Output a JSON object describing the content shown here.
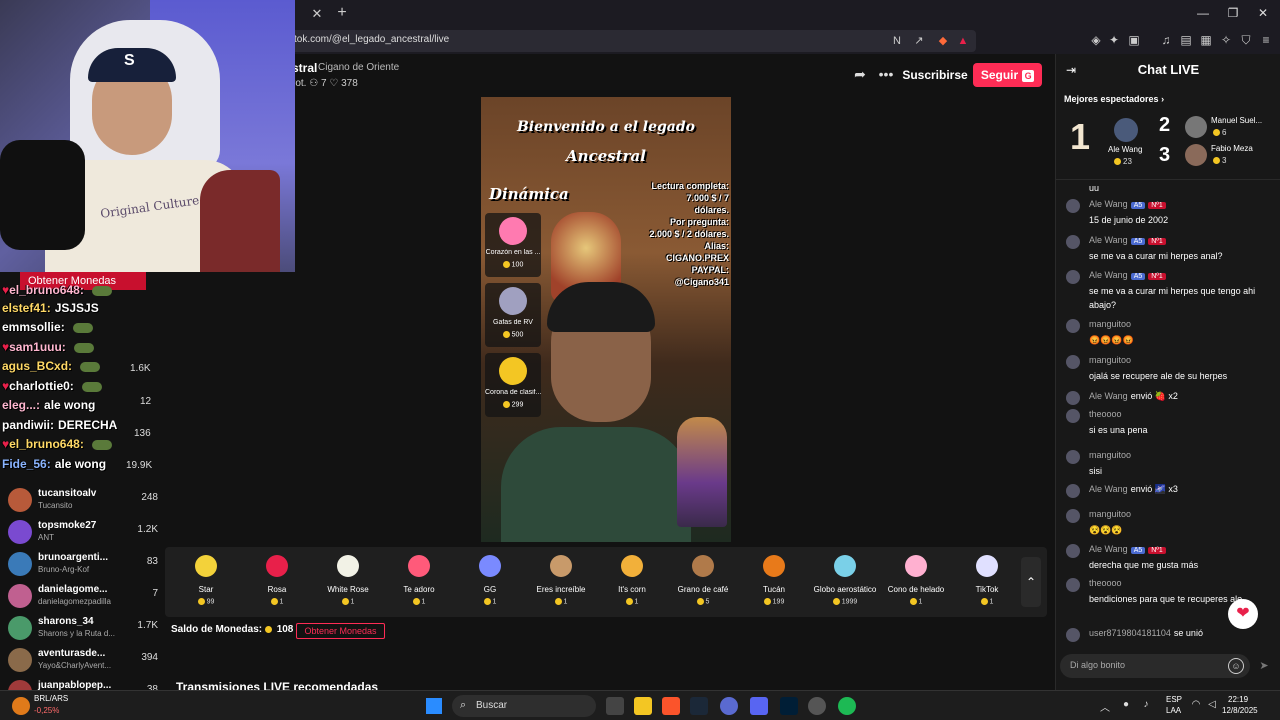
{
  "browser": {
    "url": "tok.com/@el_legado_ancestral/live",
    "tab_close": "✕",
    "tab_new": "+",
    "min": "—",
    "restore": "❐",
    "close": "✕"
  },
  "stream": {
    "name_fragment": "stral",
    "subtitle": "Cigano de Oriente",
    "stats_prefix": "rot.",
    "members": "7",
    "likes": "378",
    "subscribe": "Suscribirse",
    "follow": "Seguir",
    "follow_key": "G"
  },
  "webcam": {
    "shirt_text": "Original Culture",
    "hat_logo": "S"
  },
  "overlay_chat": {
    "coin_button": "Obtener Monedas",
    "lines": [
      {
        "name": "el_bruno648:",
        "msg": "",
        "heart": true,
        "color": "pink"
      },
      {
        "name": "elstef41:",
        "msg": "JSJSJS",
        "heart": false,
        "color": "y"
      },
      {
        "name": "emmsollie:",
        "msg": "",
        "heart": false,
        "color": "w"
      },
      {
        "name": "sam1uuu:",
        "msg": "",
        "heart": true,
        "color": "pink"
      },
      {
        "name": "agus_BCxd:",
        "msg": "",
        "heart": false,
        "color": "y"
      },
      {
        "name": "charlottie0:",
        "msg": "",
        "heart": true,
        "color": "w"
      },
      {
        "name": "eleg...:",
        "msg": "ale wong",
        "heart": false,
        "color": "pink"
      },
      {
        "name": "pandiwii:",
        "msg": "DERECHA",
        "heart": false,
        "color": "w"
      },
      {
        "name": "el_bruno648:",
        "msg": "",
        "heart": true,
        "color": "y"
      },
      {
        "name": "Fide_56:",
        "msg": "ale wong",
        "heart": false,
        "color": "b"
      }
    ]
  },
  "sidebar": {
    "items": [
      {
        "name": "tucansitoalv",
        "sub": "Tucansito",
        "count": "248"
      },
      {
        "name": "topsmoke27",
        "sub": "ANT",
        "count": "1.2K"
      },
      {
        "name": "brunoargenti...",
        "sub": "Bruno-Arg-Kof",
        "count": "83"
      },
      {
        "name": "danielagome...",
        "sub": "danielagomezpadilla",
        "count": "7"
      },
      {
        "name": "sharons_34",
        "sub": "Sharons y la Ruta d...",
        "count": "1.7K"
      },
      {
        "name": "aventurasde...",
        "sub": "Yayo&CharlyAvent...",
        "count": "394"
      },
      {
        "name": "juanpablopер...",
        "sub": "",
        "count": "38"
      }
    ],
    "hidden_counts": [
      "1.6K",
      "12",
      "136",
      "19.9K"
    ]
  },
  "video": {
    "title1": "Bienvenido a el legado",
    "title2": "Ancestral",
    "dinamica": "Dinámica",
    "info_lines": [
      "Lectura completa:",
      "7.000 $ / 7",
      "dólares.",
      "Por pregunta:",
      "2.000 $ / 2 dólares.",
      "Alias:",
      "CIGANO.PREX",
      "PAYPAL:",
      "@Cigano341"
    ],
    "gifts": [
      {
        "label": "Corazón en las ...",
        "count": "100",
        "color": "#ff7ab0"
      },
      {
        "label": "Gafas de RV",
        "count": "500",
        "color": "#a0a0c0"
      },
      {
        "label": "Corona de clasif...",
        "count": "299",
        "color": "#f3c623"
      }
    ]
  },
  "gift_bar": {
    "gifts": [
      {
        "name": "Star",
        "price": "99",
        "color": "#f3d23a"
      },
      {
        "name": "Rosa",
        "price": "1",
        "color": "#e8204a"
      },
      {
        "name": "White Rose",
        "price": "1",
        "color": "#f2f2e6"
      },
      {
        "name": "Te adoro",
        "price": "1",
        "color": "#ff5a7a"
      },
      {
        "name": "GG",
        "price": "1",
        "color": "#7a8aff"
      },
      {
        "name": "Eres increíble",
        "price": "1",
        "color": "#c89a6a"
      },
      {
        "name": "It's corn",
        "price": "1",
        "color": "#f2b03a"
      },
      {
        "name": "Grano de café",
        "price": "5",
        "color": "#b07a4a"
      },
      {
        "name": "Tucán",
        "price": "199",
        "color": "#e87a1a"
      },
      {
        "name": "Globo aerostático",
        "price": "1999",
        "color": "#7ad0e8"
      },
      {
        "name": "Cono de helado",
        "price": "1",
        "color": "#ffb0d0"
      },
      {
        "name": "TikTok",
        "price": "1",
        "color": "#e0e0ff"
      }
    ],
    "expand": "⌃",
    "balance_label": "Saldo de Monedas:",
    "balance": "108",
    "get_coins": "Obtener Monedas",
    "recommended": "Transmisiones LIVE recomendadas"
  },
  "chat": {
    "title": "Chat LIVE",
    "collapse": "⇥",
    "viewers_label": "Mejores espectadores",
    "rank1": {
      "num": "1",
      "name": "Ale Wang",
      "coins": "23"
    },
    "rank2": {
      "num": "2",
      "name": "Manuel Suel...",
      "coins": "6"
    },
    "rank3": {
      "num": "3",
      "name": "Fabio Meza",
      "coins": "3"
    },
    "messages": [
      {
        "name": "",
        "text": "uu",
        "badges": false
      },
      {
        "name": "Ale Wang",
        "text": "15 de junio de 2002",
        "badges": true
      },
      {
        "name": "Ale Wang",
        "text": "se me va a curar mi herpes anal?",
        "badges": true
      },
      {
        "name": "Ale Wang",
        "text": "se me va a curar mi herpes que tengo ahi abajo?",
        "badges": true
      },
      {
        "name": "manguitoo",
        "text": "😡😡😡😡",
        "badges": false
      },
      {
        "name": "manguitoo",
        "text": "ojalá se recupere ale de su herpes",
        "badges": false
      },
      {
        "name": "Ale Wang",
        "text": "",
        "inline": "envió 🍓 x2",
        "badges": false
      },
      {
        "name": "theoooo",
        "text": "si es una pena",
        "badges": false
      },
      {
        "name": "manguitoo",
        "text": "sisi",
        "badges": false
      },
      {
        "name": "Ale Wang",
        "text": "",
        "inline": "envió 🌌 x3",
        "badges": false
      },
      {
        "name": "manguitoo",
        "text": "😵😵😵",
        "badges": false
      },
      {
        "name": "Ale Wang",
        "text": "derecha que me gusta más",
        "badges": true
      },
      {
        "name": "theoooo",
        "text": "bendiciones para que te recuperes ale",
        "badges": false
      },
      {
        "name": "user8719804181104",
        "text": "",
        "inline": "se unió",
        "badges": false
      }
    ],
    "badge_level": "A5",
    "badge_top": "Nº1",
    "input_placeholder": "Di algo bonito",
    "heart": "❤"
  },
  "taskbar": {
    "weather_1": "BRL/ARS",
    "weather_2": "-0,25%",
    "search": "Buscar",
    "lang1": "ESP",
    "lang2": "LAA",
    "time": "22:19",
    "date": "12/8/2025"
  },
  "colors": {
    "accent": "#fe2c55",
    "panel": "#181818",
    "background": "#121212"
  }
}
